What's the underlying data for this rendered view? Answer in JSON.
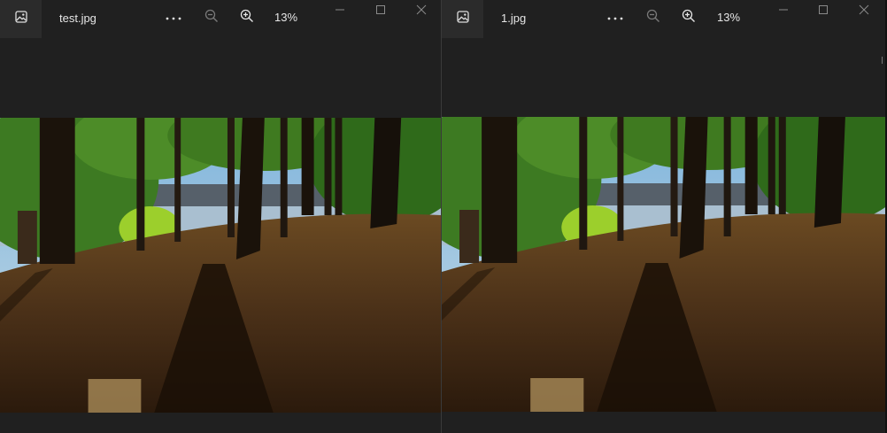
{
  "windows": [
    {
      "filename": "test.jpg",
      "zoom": "13%",
      "icons": {
        "app": "image-icon",
        "more": "more-options-icon",
        "zoom_out": "zoom-out-icon",
        "zoom_in": "zoom-in-icon",
        "minimize": "minimize-icon",
        "maximize": "maximize-icon",
        "close": "close-icon"
      }
    },
    {
      "filename": "1.jpg",
      "zoom": "13%",
      "icons": {
        "app": "image-icon",
        "more": "more-options-icon",
        "zoom_out": "zoom-out-icon",
        "zoom_in": "zoom-in-icon",
        "minimize": "minimize-icon",
        "maximize": "maximize-icon",
        "close": "close-icon"
      }
    }
  ],
  "colors": {
    "background": "#202020",
    "titlebar_accent": "#2b2b2b",
    "text": "#e6e6e6",
    "icon_dim": "#7a7a7a"
  }
}
